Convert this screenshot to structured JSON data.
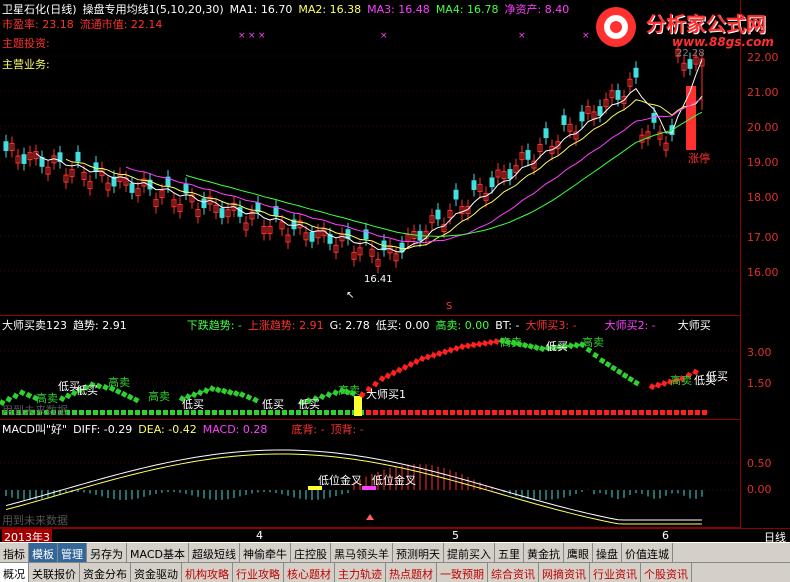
{
  "main": {
    "title": "卫星石化(日线)",
    "indicator_name": "操盘专用均线1(5,10,20,30)",
    "ma1_label": "MA1: 16.70",
    "ma2_label": "MA2: 16.38",
    "ma3_label": "MA3: 16.48",
    "ma4_label": "MA4: 16.78",
    "net_asset": "净资产: 8.40",
    "pe_label": "市盈率: 23.18",
    "float_cap": "流通市值: 22.14",
    "topic_label": "主题投资:",
    "business_label": "主营业务:",
    "low_price": "16.41",
    "top_price": "22.28",
    "limit_up": "涨停",
    "marker_s": "S",
    "y_ticks": [
      "22.00",
      "21.00",
      "20.00",
      "19.00",
      "18.00",
      "17.00",
      "16.00"
    ]
  },
  "ind1": {
    "name": "大师买卖123",
    "trend": "趋势: 2.91",
    "down_trend": "下跌趋势: -",
    "up_trend": "上涨趋势: 2.91",
    "g": "G: 2.78",
    "low_buy": "低买: 0.00",
    "high_sell": "高卖: 0.00",
    "bt": "BT: -",
    "master_buy3": "大师买3: -",
    "master_buy2": "大师买2: -",
    "master_buy": "大师买",
    "watermark": "用到未来数据",
    "y_ticks": [
      "3.00",
      "1.50"
    ],
    "annotations": [
      {
        "text": "高卖",
        "color": "#30d030"
      },
      {
        "text": "低买",
        "color": "#ffffff"
      },
      {
        "text": "高卖",
        "color": "#30d030"
      },
      {
        "text": "低买",
        "color": "#ffffff"
      },
      {
        "text": "高卖",
        "color": "#30d030"
      },
      {
        "text": "低买",
        "color": "#ffffff"
      },
      {
        "text": "低买",
        "color": "#ffffff"
      },
      {
        "text": "低买",
        "color": "#ffffff"
      },
      {
        "text": "高卖",
        "color": "#30d030"
      },
      {
        "text": "大师买1",
        "color": "#ffffff"
      },
      {
        "text": "高卖",
        "color": "#30d030"
      },
      {
        "text": "低买",
        "color": "#ffffff"
      },
      {
        "text": "高卖",
        "color": "#30d030"
      },
      {
        "text": "低买",
        "color": "#ffffff"
      },
      {
        "text": "高卖",
        "color": "#30d030"
      },
      {
        "text": "低买",
        "color": "#ffffff"
      }
    ]
  },
  "ind2": {
    "name": "MACD叫\"好\"",
    "diff": "DIFF: -0.29",
    "dea": "DEA: -0.42",
    "macd": "MACD: 0.28",
    "bottom_div": "底背: -",
    "top_div": "顶背: -",
    "watermark": "用到未来数据",
    "low_golden_cross": "低位金叉",
    "low_golden_cross2": "低位金叉",
    "y_ticks": [
      "0.50",
      "0.00"
    ]
  },
  "date_bar": {
    "year": "2013年3",
    "months": [
      "4",
      "5",
      "6"
    ],
    "cycle": "日线"
  },
  "tabs_row1": [
    "指标",
    "模板",
    "管理",
    "另存为",
    "MACD基本",
    "超级短线",
    "神偷牵牛",
    "庄控股",
    "黑马领头羊",
    "预测明天",
    "提前买入",
    "五里",
    "黄金抗",
    "鹰眼",
    "操盘",
    "价值连城"
  ],
  "tabs_row2": [
    "概况",
    "关联报价",
    "资金分布",
    "资金驱动",
    "机构攻略",
    "行业攻略",
    "核心题材",
    "主力轨迹",
    "热点题材",
    "一致预期",
    "综合资讯",
    "网摘资讯",
    "行业资讯",
    "个股资讯"
  ],
  "logo": {
    "title": "分析家公式网",
    "url": "www.88gs.com"
  },
  "colors": {
    "up": "#ff3030",
    "down": "#40e0e0",
    "ma1": "#ffffff",
    "ma2": "#ffff60",
    "ma3": "#ff40ff",
    "ma4": "#40ff40",
    "grid": "#8b0000"
  }
}
